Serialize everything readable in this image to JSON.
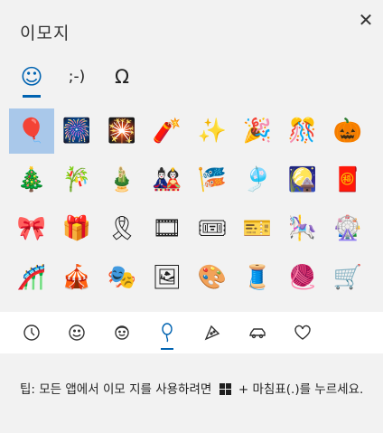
{
  "title": "이모지",
  "close_glyph": "✕",
  "tabs": [
    {
      "name": "emoji",
      "glyph": "☺",
      "active": true
    },
    {
      "name": "kaomoji",
      "glyph": ";-)",
      "active": false
    },
    {
      "name": "symbols",
      "glyph": "Ω",
      "active": false
    }
  ],
  "emoji_rows": [
    [
      "🎈",
      "🎆",
      "🎇",
      "🧨",
      "✨",
      "🎉",
      "🎊",
      "🎃"
    ],
    [
      "🎄",
      "🎋",
      "🎍",
      "🎎",
      "🎏",
      "🎐",
      "🎑",
      "🧧"
    ],
    [
      "🎀",
      "🎁",
      "🎗",
      "🎞",
      "🎟",
      "🎫",
      "🎠",
      "🎡"
    ],
    [
      "🎢",
      "🎪",
      "🎭",
      "🖼",
      "🎨",
      "🧵",
      "🧶",
      "🛒"
    ],
    [
      "👓",
      "🕶",
      "🥽",
      "🥼",
      "🦺",
      "👔",
      "👕",
      "👖"
    ]
  ],
  "selected": {
    "row": 0,
    "col": 0
  },
  "categories": [
    {
      "name": "recent",
      "icon": "clock-icon",
      "active": false
    },
    {
      "name": "smileys",
      "icon": "smiley-icon",
      "active": false
    },
    {
      "name": "people",
      "icon": "person-icon",
      "active": false
    },
    {
      "name": "celebration",
      "icon": "balloon-icon",
      "active": true
    },
    {
      "name": "food",
      "icon": "pizza-icon",
      "active": false
    },
    {
      "name": "travel",
      "icon": "car-icon",
      "active": false
    },
    {
      "name": "symbols",
      "icon": "heart-icon",
      "active": false
    }
  ],
  "tip": {
    "prefix": "팁: 모든 앱에서 이모 지를 사용하려면",
    "suffix": "+ 마침표(.)를 누르세요."
  },
  "accent": "#0063b1"
}
